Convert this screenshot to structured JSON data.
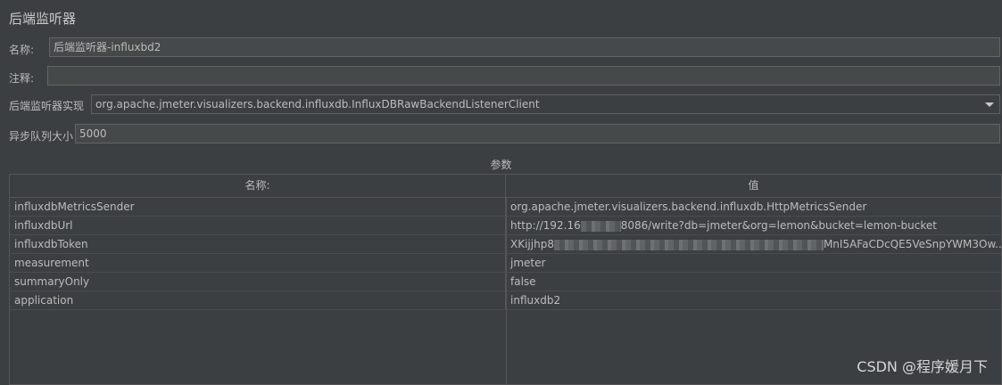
{
  "header": {
    "title": "后端监听器"
  },
  "form": {
    "name_label": "名称:",
    "name_value": "后端监听器-influxbd2",
    "comment_label": "注释:",
    "comment_value": "",
    "impl_label": "后端监听器实现",
    "impl_value": "org.apache.jmeter.visualizers.backend.influxdb.InfluxDBRawBackendListenerClient",
    "queue_label": "异步队列大小",
    "queue_value": "5000"
  },
  "params": {
    "title": "参数",
    "columns": [
      "名称:",
      "值"
    ],
    "rows": [
      {
        "name": "influxdbMetricsSender",
        "value": "org.apache.jmeter.visualizers.backend.influxdb.HttpMetricsSender"
      },
      {
        "name": "influxdbUrl",
        "value_prefix": "http://192.16",
        "value_suffix": "8086/write?db=jmeter&org=lemon&bucket=lemon-bucket"
      },
      {
        "name": "influxdbToken",
        "value_prefix": "XKijjhp8",
        "value_suffix": "MnI5AFaCDcQE5VeSnpYWM3Ow..."
      },
      {
        "name": "measurement",
        "value": "jmeter"
      },
      {
        "name": "summaryOnly",
        "value": "false"
      },
      {
        "name": "application",
        "value": "influxdb2"
      }
    ]
  },
  "watermark": "CSDN @程序媛月下"
}
